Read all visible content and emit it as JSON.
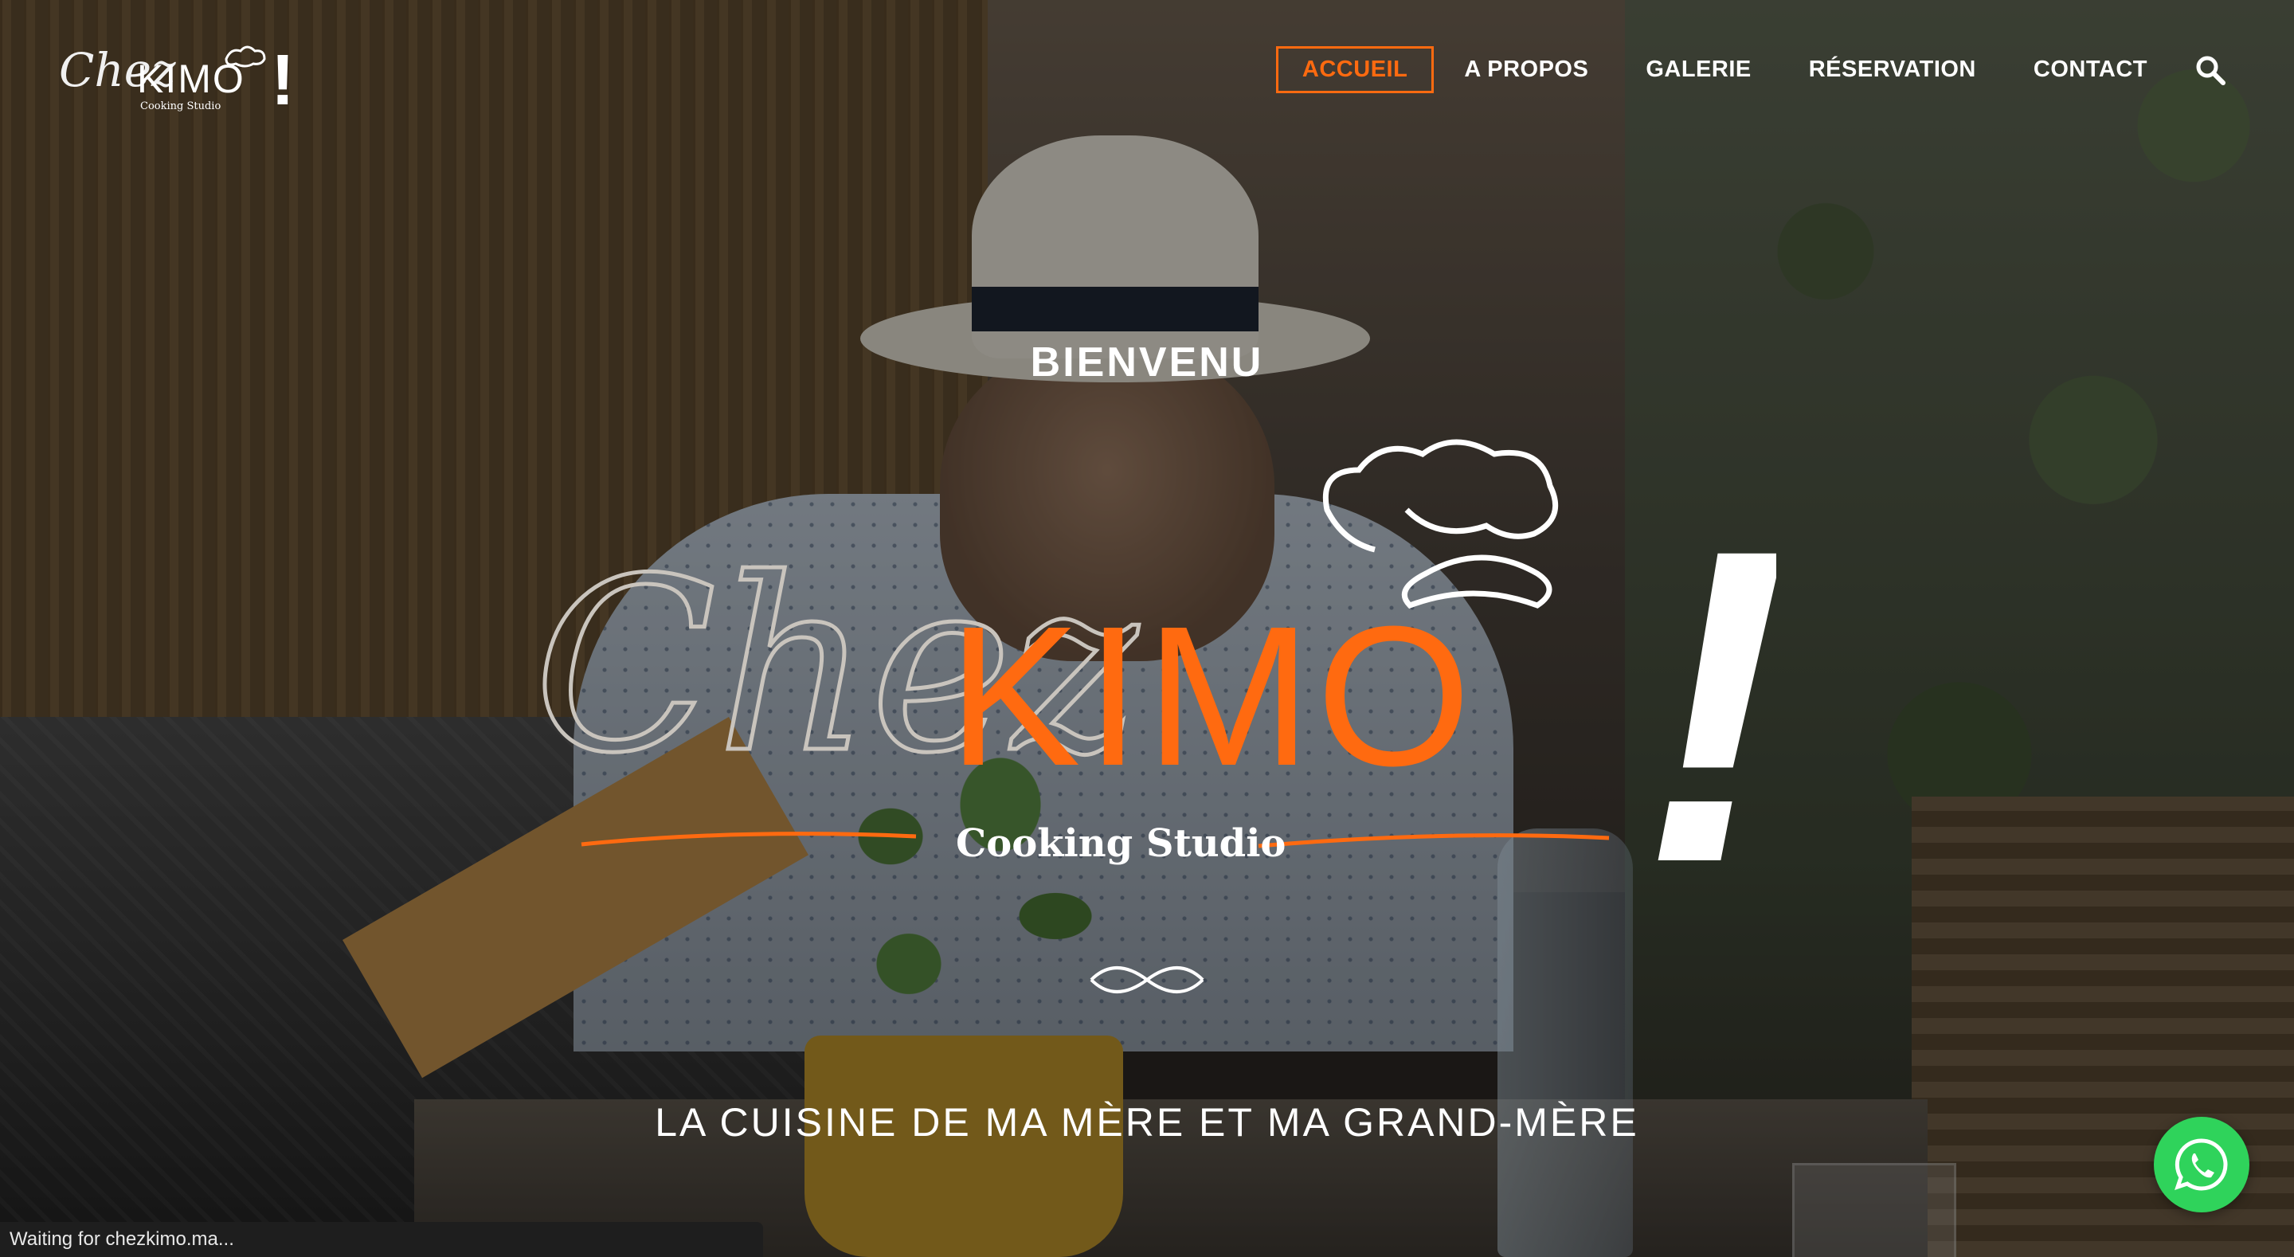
{
  "header": {
    "logo": {
      "script": "Chez",
      "word": "KIMO",
      "exclaim": "!",
      "subtitle": "Cooking Studio"
    },
    "nav": [
      {
        "label": "ACCUEIL",
        "active": true
      },
      {
        "label": "A PROPOS",
        "active": false
      },
      {
        "label": "GALERIE",
        "active": false
      },
      {
        "label": "RÉSERVATION",
        "active": false
      },
      {
        "label": "CONTACT",
        "active": false
      }
    ],
    "search_icon": "search-icon"
  },
  "hero": {
    "welcome": "BIENVENU",
    "logo": {
      "script": "Chez",
      "word": "KIMO",
      "exclaim": "!",
      "subtitle": "Cooking Studio"
    },
    "divider_icon": "ornament-icon",
    "tagline": "LA CUISINE DE MA MÈRE ET MA GRAND-MÈRE"
  },
  "whatsapp_icon": "whatsapp-icon",
  "status": "Waiting for chezkimo.ma...",
  "colors": {
    "accent": "#ff6a10",
    "text": "#ffffff",
    "whatsapp": "#2fd35b"
  }
}
